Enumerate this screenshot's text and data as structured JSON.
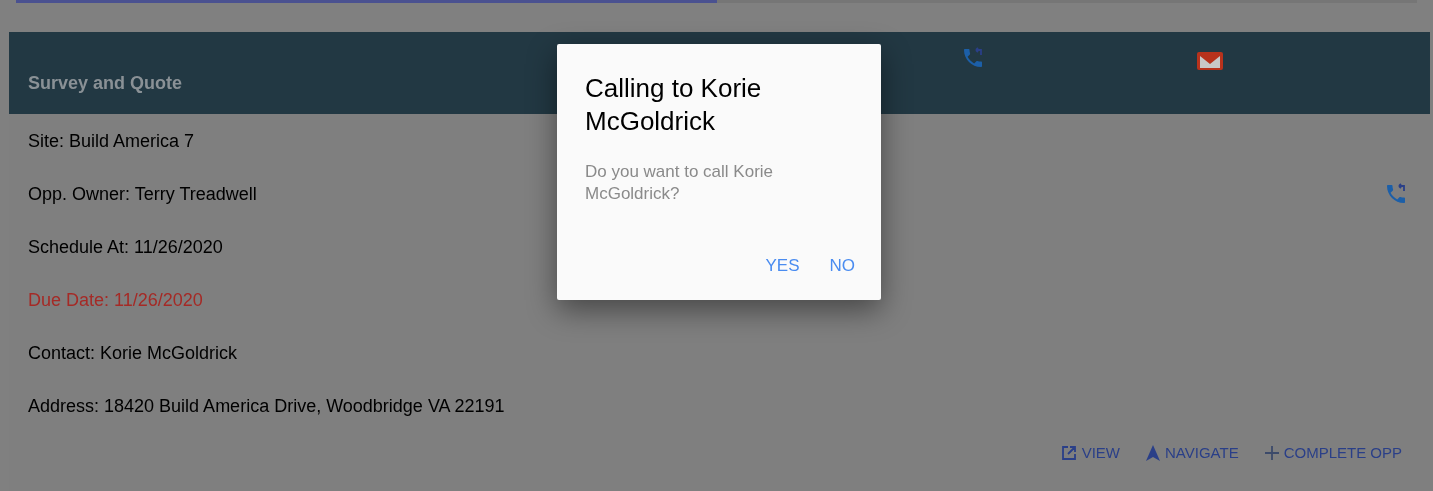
{
  "progress": {
    "level": 0.5
  },
  "card": {
    "title": "Survey and Quote",
    "fields": [
      {
        "text": "Site: Build America 7",
        "overdue": false,
        "call": false
      },
      {
        "text": "Opp. Owner: Terry Treadwell",
        "overdue": false,
        "call": true
      },
      {
        "text": "Schedule At: 11/26/2020",
        "overdue": false,
        "call": false
      },
      {
        "text": "Due Date: 11/26/2020",
        "overdue": true,
        "call": false
      },
      {
        "text": "Contact: Korie McGoldrick",
        "overdue": false,
        "call": false
      },
      {
        "text": "Address: 18420 Build America Drive, Woodbridge VA 22191",
        "overdue": false,
        "call": false
      }
    ],
    "actions": [
      {
        "kind": "view",
        "label": "VIEW"
      },
      {
        "kind": "navigate",
        "label": "NAVIGATE"
      },
      {
        "kind": "add",
        "label": "COMPLETE OPP"
      }
    ]
  },
  "dialog": {
    "title": "Calling to Korie McGoldrick",
    "message": "Do you want to call Korie McGoldrick?",
    "buttons": [
      "YES",
      "NO"
    ]
  }
}
